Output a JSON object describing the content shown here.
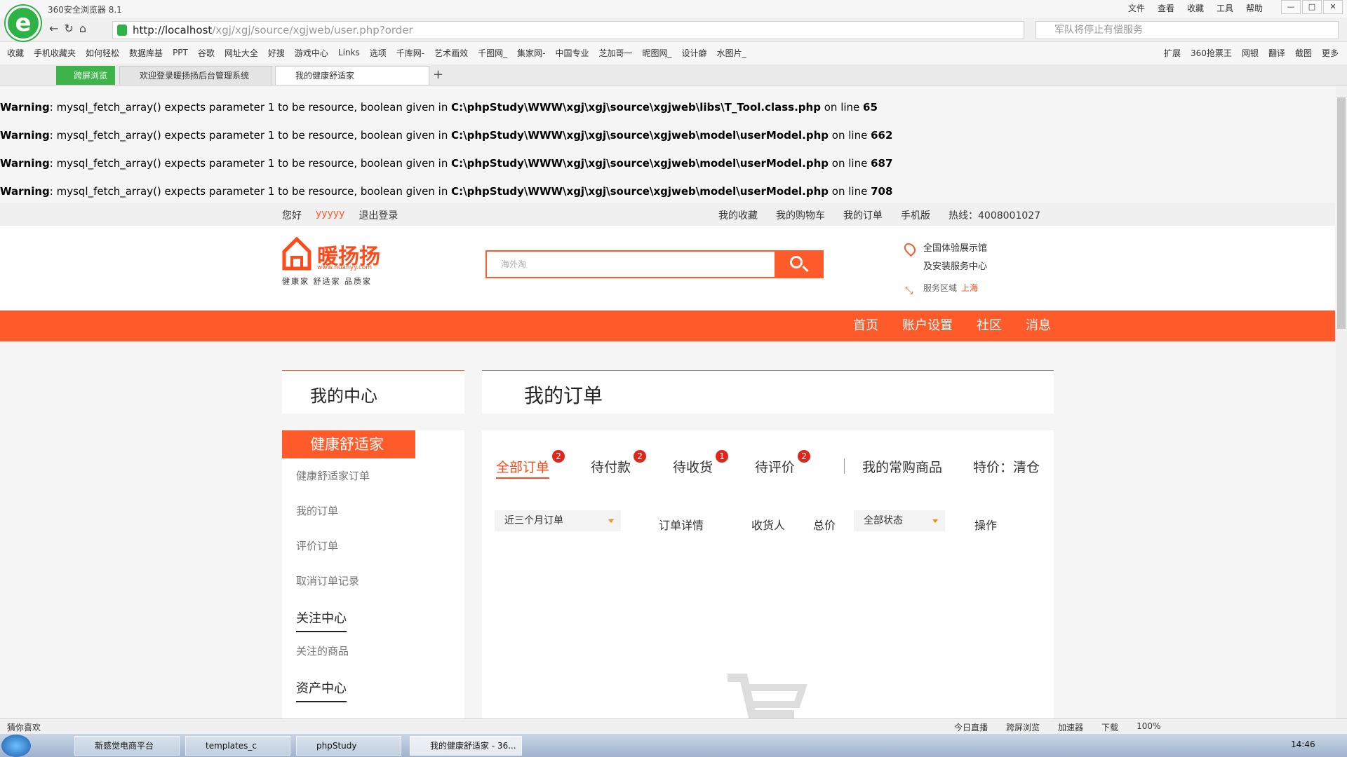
{
  "browser": {
    "title": "360安全浏览器 8.1",
    "menu": [
      "文件",
      "查看",
      "收藏",
      "工具",
      "帮助"
    ],
    "url_host": "http://localhost",
    "url_path": "/xgj/xgj/source/xgjweb/user.php?order",
    "search_placeholder": "军队将停止有偿服务",
    "bookmarks": [
      "收藏",
      "手机收藏夹",
      "如何轻松",
      "数据库基",
      "PPT",
      "谷歌",
      "网址大全",
      "好搜",
      "游戏中心",
      "Links",
      "选项",
      "千库网-",
      "艺术画效",
      "千图网_",
      "集家网-",
      "中国专业",
      "芝加哥一",
      "昵图网_",
      "设计癖",
      "水图片_"
    ],
    "bookmarks_right": [
      "扩展",
      "360抢票王",
      "网银",
      "翻译",
      "截图",
      "更多"
    ],
    "tabs": [
      "跨屏浏览",
      "欢迎登录暖扬扬后台管理系统",
      "我的健康舒适家"
    ]
  },
  "warnings": [
    {
      "label": "Warning",
      "msg": ": mysql_fetch_array() expects parameter 1 to be resource, boolean given in ",
      "file": "C:\\phpStudy\\WWW\\xgj\\xgj\\source\\xgjweb\\libs\\T_Tool.class.php",
      "online": " on line ",
      "line": "65"
    },
    {
      "label": "Warning",
      "msg": ": mysql_fetch_array() expects parameter 1 to be resource, boolean given in ",
      "file": "C:\\phpStudy\\WWW\\xgj\\xgj\\source\\xgjweb\\model\\userModel.php",
      "online": " on line ",
      "line": "662"
    },
    {
      "label": "Warning",
      "msg": ": mysql_fetch_array() expects parameter 1 to be resource, boolean given in ",
      "file": "C:\\phpStudy\\WWW\\xgj\\xgj\\source\\xgjweb\\model\\userModel.php",
      "online": " on line ",
      "line": "687"
    },
    {
      "label": "Warning",
      "msg": ": mysql_fetch_array() expects parameter 1 to be resource, boolean given in ",
      "file": "C:\\phpStudy\\WWW\\xgj\\xgj\\source\\xgjweb\\model\\userModel.php",
      "online": " on line ",
      "line": "708"
    }
  ],
  "topbar": {
    "hello": "您好",
    "user": "yyyyy",
    "logout": "退出登录",
    "fav": "我的收藏",
    "cart": "我的购物车",
    "orders": "我的订单",
    "mobile": "手机版",
    "hotline": "热线：4008001027"
  },
  "header": {
    "brand": "暖扬扬",
    "brand_url": "www.nuanyy.com",
    "slogan": "健康家 舒适家 品质家",
    "search_placeholder": "海外淘",
    "store1": "全国体验展示馆",
    "store2": "及安装服务中心",
    "area_label": "服务区域",
    "area": "上海"
  },
  "nav": [
    "首页",
    "账户设置",
    "社区",
    "消息"
  ],
  "left": {
    "title": "我的中心",
    "header": "健康舒适家",
    "items": [
      "健康舒适家订单",
      "我的订单",
      "评价订单",
      "取消订单记录"
    ],
    "sec1": "关注中心",
    "sec1_items": [
      "关注的商品"
    ],
    "sec2": "资产中心"
  },
  "main": {
    "title": "我的订单",
    "tabs": [
      {
        "label": "全部订单",
        "count": "2"
      },
      {
        "label": "待付款",
        "count": "2"
      },
      {
        "label": "待收货",
        "count": "1"
      },
      {
        "label": "待评价",
        "count": "2"
      }
    ],
    "extra": [
      "我的常购商品",
      "特价：清仓"
    ],
    "filter_time": "近三个月订单",
    "col_detail": "订单详情",
    "col_recv": "收货人",
    "col_total": "总价",
    "filter_status": "全部状态",
    "col_op": "操作"
  },
  "status": {
    "left": "猜你喜欢",
    "items": [
      "今日直播",
      "跨屏浏览",
      "加速器",
      "下载",
      "100%"
    ]
  },
  "taskbar": {
    "items": [
      "新感觉电商平台",
      "templates_c",
      "phpStudy",
      "我的健康舒适家 - 36..."
    ],
    "time": "14:46"
  },
  "colors": {
    "accent": "#ff5a2a",
    "badge": "#e0261b"
  }
}
